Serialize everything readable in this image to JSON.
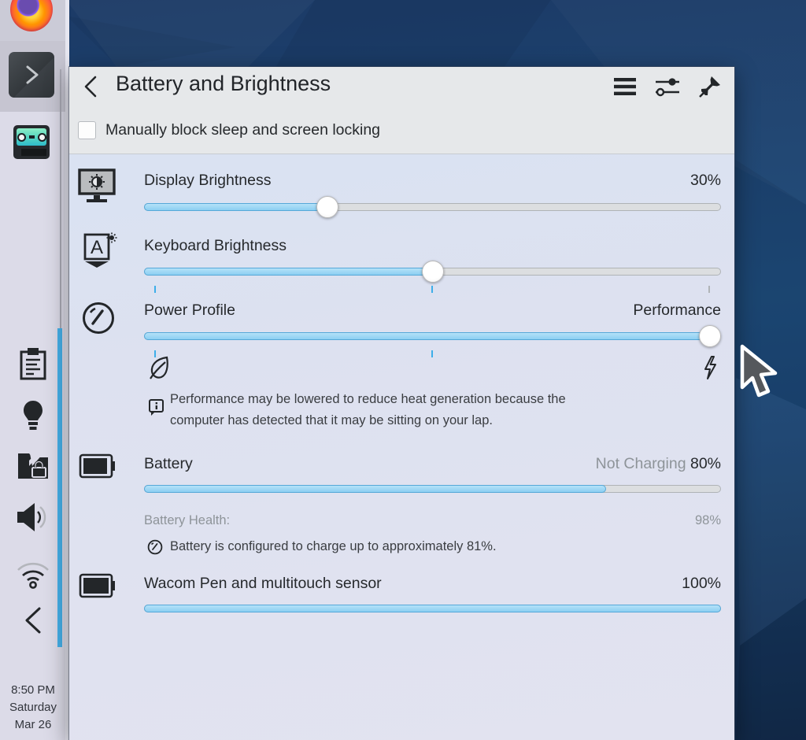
{
  "popup": {
    "title": "Battery and Brightness",
    "checkbox_label": "Manually block sleep and screen locking",
    "display": {
      "label": "Display Brightness",
      "value": "30%",
      "percent": 31
    },
    "keyboard": {
      "label": "Keyboard Brightness",
      "percent": 50
    },
    "power": {
      "label": "Power Profile",
      "value": "Performance",
      "percent": 100,
      "note_line1": "Performance may be lowered to reduce heat generation because the",
      "note_line2": "computer has detected that it may be sitting on your lap."
    },
    "battery": {
      "label": "Battery",
      "status": "Not Charging",
      "value": "80%",
      "percent": 80,
      "health_label": "Battery Health:",
      "health_value": "98%",
      "charge_note": "Battery is configured to charge up to approximately 81%."
    },
    "wacom": {
      "label": "Wacom Pen and multitouch sensor",
      "value": "100%",
      "percent": 100
    }
  },
  "panel": {
    "clock": {
      "time": "8:50 PM",
      "day": "Saturday",
      "date": "Mar 26"
    }
  },
  "colors": {
    "accent": "#3daee9",
    "slider_fill": "#8ccff2",
    "desktop": "#1d4a78",
    "panel_bg": "#dcdbe8"
  }
}
